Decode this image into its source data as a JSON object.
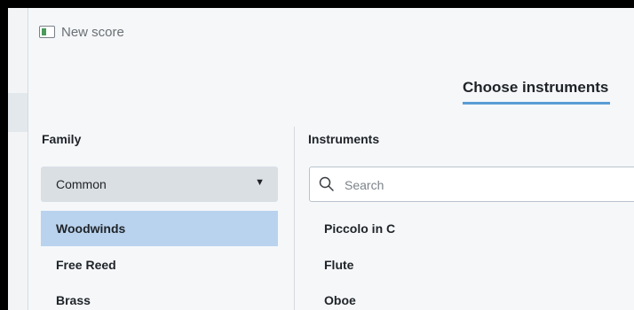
{
  "dialog": {
    "title": "New score",
    "active_tab": "Choose instruments"
  },
  "family": {
    "heading": "Family",
    "dropdown_value": "Common",
    "items": [
      {
        "label": "Woodwinds",
        "selected": true
      },
      {
        "label": "Free Reed",
        "selected": false
      },
      {
        "label": "Brass",
        "selected": false
      }
    ]
  },
  "instruments": {
    "heading": "Instruments",
    "search_placeholder": "Search",
    "items": [
      {
        "label": "Piccolo in C"
      },
      {
        "label": "Flute"
      },
      {
        "label": "Oboe"
      }
    ]
  },
  "icons": {
    "app": "musescore-app-icon",
    "search": "search-icon",
    "dropdown": "caret-down-icon"
  },
  "colors": {
    "selected_row": "#b9d3ee",
    "tab_underline": "#5b9bd5",
    "dialog_bg": "#f5f7f9"
  }
}
